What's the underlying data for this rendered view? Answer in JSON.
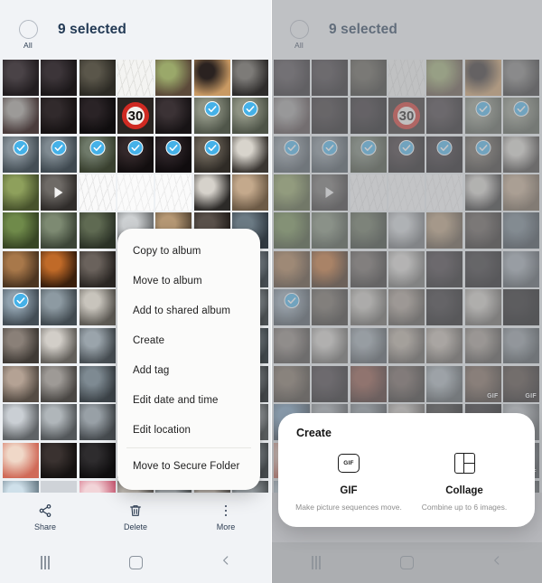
{
  "left_panel": {
    "header": {
      "select_all_label": "All",
      "select_all_icon": "circle-unchecked-icon",
      "selected_count": "9 selected"
    },
    "context_menu": {
      "items": [
        {
          "label": "Copy to album"
        },
        {
          "label": "Move to album"
        },
        {
          "label": "Add to shared album"
        },
        {
          "label": "Create"
        },
        {
          "label": "Add tag"
        },
        {
          "label": "Edit date and time"
        },
        {
          "label": "Edit location"
        },
        {
          "label": "Move to Secure Folder",
          "separator_before": true
        }
      ]
    },
    "action_bar": {
      "actions": [
        {
          "label": "Share",
          "icon": "share-icon"
        },
        {
          "label": "Delete",
          "icon": "trash-icon"
        },
        {
          "label": "More",
          "icon": "more-vertical-icon"
        }
      ]
    },
    "nav_bar": {
      "recents_icon": "recents-icon",
      "home_icon": "home-icon",
      "back_icon": "back-icon"
    }
  },
  "right_panel": {
    "header": {
      "select_all_label": "All",
      "select_all_icon": "circle-unchecked-icon",
      "selected_count": "9 selected"
    },
    "create_sheet": {
      "title": "Create",
      "options": [
        {
          "name": "GIF",
          "icon": "gif-icon",
          "icon_text": "GIF",
          "description": "Make picture sequences move."
        },
        {
          "name": "Collage",
          "icon": "collage-icon",
          "description": "Combine up to 6 images."
        }
      ]
    },
    "action_bar": {
      "actions": [
        {
          "label": "Share",
          "icon": "share-icon"
        },
        {
          "label": "Delete",
          "icon": "trash-icon"
        },
        {
          "label": "More",
          "icon": "more-vertical-icon"
        }
      ]
    },
    "nav_bar": {
      "recents_icon": "recents-icon",
      "home_icon": "home-icon",
      "back_icon": "back-icon"
    }
  },
  "colors": {
    "selection_blue": "#45b1e8",
    "header_text": "#233a55",
    "panel_bg": "#eef1f4",
    "sheet_bg": "#ffffff",
    "menu_bg": "#fbfbfa",
    "dim_overlay": "rgba(150,152,155,0.55)"
  },
  "grid": {
    "columns": 7,
    "badge_check_icon": "check-icon",
    "badge_gif_text": "GIF",
    "badge_play_icon": "play-icon",
    "sign_label": "30",
    "left_cells": [
      {
        "r": 0,
        "c": 0,
        "a": "#4a4347",
        "b": "#221d20"
      },
      {
        "r": 0,
        "c": 1,
        "a": "#3c3539",
        "b": "#1b1719"
      },
      {
        "r": 0,
        "c": 2,
        "a": "#5a564a",
        "b": "#2c2a24"
      },
      {
        "r": 0,
        "c": 3,
        "a": "#f4f4f2",
        "b": "#e2e2df",
        "sketch": true
      },
      {
        "r": 0,
        "c": 4,
        "a": "#9aa86a",
        "b": "#5c4a3a"
      },
      {
        "r": 0,
        "c": 5,
        "a": "#2a2220",
        "b": "#c99a63"
      },
      {
        "r": 0,
        "c": 6,
        "a": "#7d7b78",
        "b": "#2e2c2b"
      },
      {
        "r": 1,
        "c": 0,
        "a": "#9c9a98",
        "b": "#4a3c3c"
      },
      {
        "r": 1,
        "c": 1,
        "a": "#312a2c",
        "b": "#161213"
      },
      {
        "r": 1,
        "c": 2,
        "a": "#2a2326",
        "b": "#0f0d0e"
      },
      {
        "r": 1,
        "c": 3,
        "sign": true
      },
      {
        "r": 1,
        "c": 4,
        "a": "#3b3235",
        "b": "#171315"
      },
      {
        "r": 1,
        "c": 5,
        "a": "#8f9484",
        "b": "#50564a",
        "check": true
      },
      {
        "r": 1,
        "c": 6,
        "a": "#8e9383",
        "b": "#4e5448",
        "check": true
      },
      {
        "r": 2,
        "c": 0,
        "a": "#87929a",
        "b": "#444e55",
        "check": true
      },
      {
        "r": 2,
        "c": 1,
        "a": "#7f8a91",
        "b": "#3f4950",
        "check": true
      },
      {
        "r": 2,
        "c": 2,
        "a": "#6f7a6a",
        "b": "#39402f",
        "check": true
      },
      {
        "r": 2,
        "c": 3,
        "a": "#33282a",
        "b": "#120e0f",
        "check": true
      },
      {
        "r": 2,
        "c": 4,
        "a": "#2d2428",
        "b": "#100c0e",
        "check": true
      },
      {
        "r": 2,
        "c": 5,
        "a": "#6b6358",
        "b": "#2f2b26",
        "check": true
      },
      {
        "r": 2,
        "c": 6,
        "a": "#d8d4cc",
        "b": "#3a3632"
      },
      {
        "r": 3,
        "c": 0,
        "a": "#8ea05c",
        "b": "#47522c"
      },
      {
        "r": 3,
        "c": 1,
        "a": "#6e6a66",
        "b": "#2f2c2a",
        "play": true
      },
      {
        "r": 3,
        "c": 2,
        "a": "#fafafa",
        "b": "#e8e8e8",
        "sketch": true
      },
      {
        "r": 3,
        "c": 3,
        "a": "#fbfbfb",
        "b": "#eeeeee",
        "sketch": true
      },
      {
        "r": 3,
        "c": 4,
        "a": "#fbfbfb",
        "b": "#ececec",
        "sketch": true
      },
      {
        "r": 3,
        "c": 5,
        "a": "#d6d2cb",
        "b": "#2c2a28"
      },
      {
        "r": 3,
        "c": 6,
        "a": "#c4a98c",
        "b": "#6c5a46"
      },
      {
        "r": 4,
        "c": 0,
        "a": "#6f8a4a",
        "b": "#374524"
      },
      {
        "r": 4,
        "c": 1,
        "a": "#7d8a72",
        "b": "#3c4537"
      },
      {
        "r": 4,
        "c": 2,
        "a": "#5f6a52",
        "b": "#2c3327"
      },
      {
        "r": 4,
        "c": 3,
        "a": "#cfd2d4",
        "b": "#6b6e70"
      },
      {
        "r": 4,
        "c": 4,
        "a": "#b89a76",
        "b": "#5a4a38"
      },
      {
        "r": 4,
        "c": 5,
        "a": "#5b524c",
        "b": "#241f1c"
      },
      {
        "r": 4,
        "c": 6,
        "a": "#6d7c86",
        "b": "#333c44"
      },
      {
        "r": 5,
        "c": 0,
        "a": "#a8784a",
        "b": "#4c3520"
      },
      {
        "r": 5,
        "c": 1,
        "a": "#c06a28",
        "b": "#3a1f0c"
      },
      {
        "r": 5,
        "c": 2,
        "a": "#6a625c",
        "b": "#2b2724"
      },
      {
        "r": 5,
        "c": 3,
        "a": "#d9d6d1",
        "b": "#6c6a66"
      },
      {
        "r": 5,
        "c": 4,
        "a": "#3a3236",
        "b": "#151213"
      },
      {
        "r": 5,
        "c": 5,
        "a": "#2e2a2c",
        "b": "#0f0d0e"
      },
      {
        "r": 5,
        "c": 6,
        "a": "#9ca5ad",
        "b": "#4a5157"
      },
      {
        "r": 6,
        "c": 0,
        "a": "#8fa0ad",
        "b": "#434d55",
        "check": true
      },
      {
        "r": 6,
        "c": 1,
        "a": "#8d9aa2",
        "b": "#414a50"
      },
      {
        "r": 6,
        "c": 2,
        "a": "#c8c4bc",
        "b": "#5f5c56"
      },
      {
        "r": 6,
        "c": 3,
        "a": "#a79a8e",
        "b": "#4d4740"
      },
      {
        "r": 6,
        "c": 4,
        "a": "#b3a596",
        "b": "#544e46"
      },
      {
        "r": 6,
        "c": 5,
        "a": "#cfcac2",
        "b": "#64605a"
      },
      {
        "r": 6,
        "c": 6,
        "a": "#a9b0b6",
        "b": "#4f5457"
      },
      {
        "r": 7,
        "c": 0,
        "a": "#8a8078",
        "b": "#3f3a35"
      },
      {
        "r": 7,
        "c": 1,
        "a": "#d2cec8",
        "b": "#63605b"
      },
      {
        "r": 7,
        "c": 2,
        "a": "#9aa4ab",
        "b": "#484f54"
      },
      {
        "r": 7,
        "c": 3,
        "a": "#b6aa9c",
        "b": "#565049"
      },
      {
        "r": 7,
        "c": 4,
        "a": "#c1b6aa",
        "b": "#5c564f"
      },
      {
        "r": 7,
        "c": 5,
        "a": "#a0968c",
        "b": "#4a4540"
      },
      {
        "r": 7,
        "c": 6,
        "a": "#8e969c",
        "b": "#434a4e"
      },
      {
        "r": 8,
        "c": 0,
        "a": "#b4a294",
        "b": "#554c44"
      },
      {
        "r": 8,
        "c": 1,
        "a": "#9e9a96",
        "b": "#4a4744"
      },
      {
        "r": 8,
        "c": 2,
        "a": "#7e8a92",
        "b": "#3d4449"
      },
      {
        "r": 8,
        "c": 3,
        "a": "#cdc6bc",
        "b": "#615d57"
      },
      {
        "r": 8,
        "c": 4,
        "a": "#a6b0b6",
        "b": "#4e5457"
      },
      {
        "r": 8,
        "c": 5,
        "a": "#b8aa9a",
        "b": "#575048"
      },
      {
        "r": 8,
        "c": 6,
        "a": "#92989c",
        "b": "#45494c"
      },
      {
        "r": 9,
        "c": 0,
        "a": "#cacfd4",
        "b": "#5f6366"
      },
      {
        "r": 9,
        "c": 1,
        "a": "#b0b6ba",
        "b": "#53575a"
      },
      {
        "r": 9,
        "c": 2,
        "a": "#98a0a6",
        "b": "#474c50"
      },
      {
        "r": 9,
        "c": 3,
        "a": "#d4cfc8",
        "b": "#645f5a"
      },
      {
        "r": 9,
        "c": 4,
        "a": "#bcb4ac",
        "b": "#5a5550"
      },
      {
        "r": 9,
        "c": 5,
        "a": "#a8aeb2",
        "b": "#4f5356"
      },
      {
        "r": 9,
        "c": 6,
        "a": "#c2c6ca",
        "b": "#5c6062"
      },
      {
        "r": 10,
        "c": 0,
        "a": "#f0d8c8",
        "b": "#d06a58"
      },
      {
        "r": 10,
        "c": 1,
        "a": "#3a3230",
        "b": "#141110"
      },
      {
        "r": 10,
        "c": 2,
        "a": "#2e2c2e",
        "b": "#0f0e0f"
      },
      {
        "r": 10,
        "c": 3,
        "a": "#b6aea6",
        "b": "#565250"
      },
      {
        "r": 10,
        "c": 4,
        "a": "#a2aab0",
        "b": "#4c5154"
      },
      {
        "r": 10,
        "c": 5,
        "a": "#cfc8c0",
        "b": "#615d58"
      },
      {
        "r": 10,
        "c": 6,
        "a": "#9aa2a8",
        "b": "#484d50"
      },
      {
        "r": 11,
        "c": 0,
        "a": "#cfe0ea",
        "b": "#6a7d88"
      },
      {
        "r": 11,
        "c": 1,
        "a": "#d8e4ec",
        "b": "#7080 8a"
      },
      {
        "r": 11,
        "c": 2,
        "a": "#f2d4d8",
        "b": "#d0607a"
      },
      {
        "r": 11,
        "c": 3,
        "a": "#c6c0b8",
        "b": "#5e5a56"
      },
      {
        "r": 11,
        "c": 4,
        "a": "#aeb4b8",
        "b": "#525658"
      },
      {
        "r": 11,
        "c": 5,
        "a": "#bdb5ad",
        "b": "#5a5652"
      },
      {
        "r": 11,
        "c": 6,
        "a": "#a4abb0",
        "b": "#4d5254"
      }
    ],
    "right_cells": [
      {
        "r": 0,
        "c": 0,
        "a": "#4a4347",
        "b": "#221d20"
      },
      {
        "r": 0,
        "c": 1,
        "a": "#3c3539",
        "b": "#1b1719"
      },
      {
        "r": 0,
        "c": 2,
        "a": "#5a564a",
        "b": "#2c2a24"
      },
      {
        "r": 0,
        "c": 3,
        "a": "#f4f4f2",
        "b": "#e2e2df",
        "sketch": true
      },
      {
        "r": 0,
        "c": 4,
        "a": "#9aa86a",
        "b": "#5c4a3a"
      },
      {
        "r": 0,
        "c": 5,
        "a": "#2a2220",
        "b": "#c99a63"
      },
      {
        "r": 0,
        "c": 6,
        "a": "#7d7b78",
        "b": "#2e2c2b"
      },
      {
        "r": 1,
        "c": 0,
        "a": "#9c9a98",
        "b": "#4a3c3c"
      },
      {
        "r": 1,
        "c": 1,
        "a": "#312a2c",
        "b": "#161213"
      },
      {
        "r": 1,
        "c": 2,
        "a": "#2a2326",
        "b": "#0f0d0e"
      },
      {
        "r": 1,
        "c": 3,
        "sign": true
      },
      {
        "r": 1,
        "c": 4,
        "a": "#3b3235",
        "b": "#171315"
      },
      {
        "r": 1,
        "c": 5,
        "a": "#8f9484",
        "b": "#50564a",
        "check": true
      },
      {
        "r": 1,
        "c": 6,
        "a": "#8e9383",
        "b": "#4e5448",
        "check": true
      },
      {
        "r": 2,
        "c": 0,
        "a": "#87929a",
        "b": "#444e55",
        "check": true
      },
      {
        "r": 2,
        "c": 1,
        "a": "#7f8a91",
        "b": "#3f4950",
        "check": true
      },
      {
        "r": 2,
        "c": 2,
        "a": "#6f7a6a",
        "b": "#39402f",
        "check": true
      },
      {
        "r": 2,
        "c": 3,
        "a": "#33282a",
        "b": "#120e0f",
        "check": true
      },
      {
        "r": 2,
        "c": 4,
        "a": "#2d2428",
        "b": "#100c0e",
        "check": true
      },
      {
        "r": 2,
        "c": 5,
        "a": "#6b6358",
        "b": "#2f2b26",
        "check": true
      },
      {
        "r": 2,
        "c": 6,
        "a": "#d8d4cc",
        "b": "#3a3632"
      },
      {
        "r": 3,
        "c": 0,
        "a": "#8ea05c",
        "b": "#47522c"
      },
      {
        "r": 3,
        "c": 1,
        "a": "#6e6a66",
        "b": "#2f2c2a",
        "play": true
      },
      {
        "r": 3,
        "c": 2,
        "a": "#fafafa",
        "b": "#e8e8e8",
        "sketch": true
      },
      {
        "r": 3,
        "c": 3,
        "a": "#fbfbfb",
        "b": "#eeeeee",
        "sketch": true
      },
      {
        "r": 3,
        "c": 4,
        "a": "#fbfbfb",
        "b": "#ececec",
        "sketch": true
      },
      {
        "r": 3,
        "c": 5,
        "a": "#d6d2cb",
        "b": "#2c2a28"
      },
      {
        "r": 3,
        "c": 6,
        "a": "#c4a98c",
        "b": "#6c5a46"
      },
      {
        "r": 4,
        "c": 0,
        "a": "#6f8a4a",
        "b": "#374524"
      },
      {
        "r": 4,
        "c": 1,
        "a": "#7d8a72",
        "b": "#3c4537"
      },
      {
        "r": 4,
        "c": 2,
        "a": "#5f6a52",
        "b": "#2c3327"
      },
      {
        "r": 4,
        "c": 3,
        "a": "#cfd2d4",
        "b": "#6b6e70"
      },
      {
        "r": 4,
        "c": 4,
        "a": "#b89a76",
        "b": "#5a4a38"
      },
      {
        "r": 4,
        "c": 5,
        "a": "#5b524c",
        "b": "#241f1c"
      },
      {
        "r": 4,
        "c": 6,
        "a": "#6d7c86",
        "b": "#333c44"
      },
      {
        "r": 5,
        "c": 0,
        "a": "#a8784a",
        "b": "#4c3520"
      },
      {
        "r": 5,
        "c": 1,
        "a": "#c06a28",
        "b": "#3a1f0c"
      },
      {
        "r": 5,
        "c": 2,
        "a": "#6a625c",
        "b": "#2b2724"
      },
      {
        "r": 5,
        "c": 3,
        "a": "#d9d6d1",
        "b": "#6c6a66"
      },
      {
        "r": 5,
        "c": 4,
        "a": "#3a3236",
        "b": "#151213"
      },
      {
        "r": 5,
        "c": 5,
        "a": "#2e2a2c",
        "b": "#0f0d0e"
      },
      {
        "r": 5,
        "c": 6,
        "a": "#9ca5ad",
        "b": "#4a5157"
      },
      {
        "r": 6,
        "c": 0,
        "a": "#8fa0ad",
        "b": "#434d55",
        "check": true
      },
      {
        "r": 6,
        "c": 1,
        "a": "#6a6258",
        "b": "#2f2b26"
      },
      {
        "r": 6,
        "c": 2,
        "a": "#c8c4bc",
        "b": "#5f5c56"
      },
      {
        "r": 6,
        "c": 3,
        "a": "#a79a8e",
        "b": "#4d4740"
      },
      {
        "r": 6,
        "c": 4,
        "a": "#2a2628",
        "b": "#0e0c0d"
      },
      {
        "r": 6,
        "c": 5,
        "a": "#cfcac2",
        "b": "#64605a"
      },
      {
        "r": 6,
        "c": 6,
        "a": "#1a1718",
        "b": "#070606"
      },
      {
        "r": 7,
        "c": 0,
        "a": "#8a8078",
        "b": "#3f3a35"
      },
      {
        "r": 7,
        "c": 1,
        "a": "#d2cec8",
        "b": "#63605b"
      },
      {
        "r": 7,
        "c": 2,
        "a": "#9aa4ab",
        "b": "#484f54"
      },
      {
        "r": 7,
        "c": 3,
        "a": "#b6aa9c",
        "b": "#565049"
      },
      {
        "r": 7,
        "c": 4,
        "a": "#c1b6aa",
        "b": "#5c564f"
      },
      {
        "r": 7,
        "c": 5,
        "a": "#a0968c",
        "b": "#4a4540"
      },
      {
        "r": 7,
        "c": 6,
        "a": "#8e969c",
        "b": "#434a4e"
      },
      {
        "r": 8,
        "c": 0,
        "a": "#7a6a5a",
        "b": "#3a3228"
      },
      {
        "r": 8,
        "c": 1,
        "a": "#3c3438",
        "b": "#181416"
      },
      {
        "r": 8,
        "c": 2,
        "a": "#8a4a3a",
        "b": "#3c1e18"
      },
      {
        "r": 8,
        "c": 3,
        "a": "#6a5a52",
        "b": "#2e2824"
      },
      {
        "r": 8,
        "c": 4,
        "a": "#a6b0b6",
        "b": "#4e5457"
      },
      {
        "r": 8,
        "c": 5,
        "a": "#7a6252",
        "b": "#3a2e26",
        "gif": true
      },
      {
        "r": 8,
        "c": 6,
        "a": "#4a3c34",
        "b": "#1e1816",
        "gif": true
      },
      {
        "r": 9,
        "c": 0,
        "a": "#7aa0c0",
        "b": "#3a4c5c"
      },
      {
        "r": 9,
        "c": 1,
        "a": "#b0b6ba",
        "b": "#53575a"
      },
      {
        "r": 9,
        "c": 2,
        "a": "#98a0a6",
        "b": "#474c50"
      },
      {
        "r": 9,
        "c": 3,
        "a": "#d4cfc8",
        "b": "#645f5a"
      },
      {
        "r": 9,
        "c": 4,
        "a": "#3c3a38",
        "b": "#141312"
      },
      {
        "r": 9,
        "c": 5,
        "a": "#2a2628",
        "b": "#0e0c0d"
      },
      {
        "r": 9,
        "c": 6,
        "a": "#c2c6ca",
        "b": "#5c6062"
      },
      {
        "r": 10,
        "c": 0,
        "a": "#f0d8c8",
        "b": "#d06a58"
      },
      {
        "r": 10,
        "c": 1,
        "a": "#3a3230",
        "b": "#141110"
      },
      {
        "r": 10,
        "c": 2,
        "a": "#2e2c2e",
        "b": "#0f0e0f"
      },
      {
        "r": 10,
        "c": 3,
        "a": "#b6aea6",
        "b": "#565250"
      },
      {
        "r": 10,
        "c": 4,
        "a": "#a2aab0",
        "b": "#4c5154"
      },
      {
        "r": 10,
        "c": 5,
        "a": "#cfc8c0",
        "b": "#615d58",
        "gif": true
      },
      {
        "r": 10,
        "c": 6,
        "a": "#9aa2a8",
        "b": "#484d50",
        "gif": true
      },
      {
        "r": 11,
        "c": 0,
        "a": "#cfe0ea",
        "b": "#6a7d88"
      },
      {
        "r": 11,
        "c": 1,
        "a": "#d8e4ec",
        "b": "#70808a"
      },
      {
        "r": 11,
        "c": 2,
        "a": "#f2d4d8",
        "b": "#d0607a"
      },
      {
        "r": 11,
        "c": 3,
        "a": "#c6c0b8",
        "b": "#5e5a56"
      },
      {
        "r": 11,
        "c": 4,
        "a": "#aeb4b8",
        "b": "#525658"
      },
      {
        "r": 11,
        "c": 5,
        "a": "#bdb5ad",
        "b": "#5a5652"
      },
      {
        "r": 11,
        "c": 6,
        "a": "#a4abb0",
        "b": "#4d5254"
      }
    ]
  }
}
